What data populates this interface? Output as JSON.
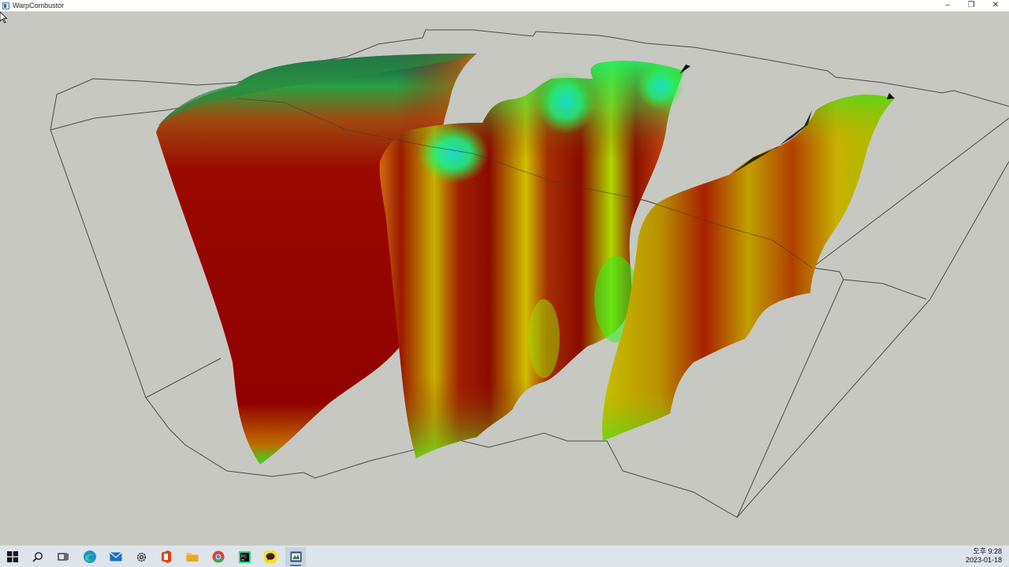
{
  "window": {
    "title": "WarpCombustor",
    "minimize_glyph": "–",
    "restore_glyph": "❐",
    "close_glyph": "✕"
  },
  "viewport": {
    "background_color": "#c8c8c2",
    "field_colormap": [
      "#8a0000",
      "#c01a00",
      "#d86a10",
      "#d8c000",
      "#b8e000",
      "#30f000",
      "#10e8d0",
      "#2060c0",
      "#104060"
    ]
  },
  "taskbar": {
    "items": [
      {
        "name": "start-icon",
        "glyph": "windows-logo"
      },
      {
        "name": "search-icon",
        "glyph": "magnifier"
      },
      {
        "name": "task-view-icon",
        "glyph": "task-view"
      },
      {
        "name": "edge-icon",
        "glyph": "browser"
      },
      {
        "name": "mail-icon",
        "glyph": "envelope"
      },
      {
        "name": "settings-icon",
        "glyph": "gear"
      },
      {
        "name": "office-icon",
        "glyph": "office"
      },
      {
        "name": "file-explorer-icon",
        "glyph": "folder"
      },
      {
        "name": "chrome-icon",
        "glyph": "chrome"
      },
      {
        "name": "pycharm-icon",
        "glyph": "pycharm"
      },
      {
        "name": "kakaotalk-icon",
        "glyph": "chat"
      },
      {
        "name": "warpcombustor-app-icon",
        "glyph": "app"
      }
    ],
    "clock": {
      "time": "오후 9:28",
      "date": "2023-01-18"
    }
  }
}
